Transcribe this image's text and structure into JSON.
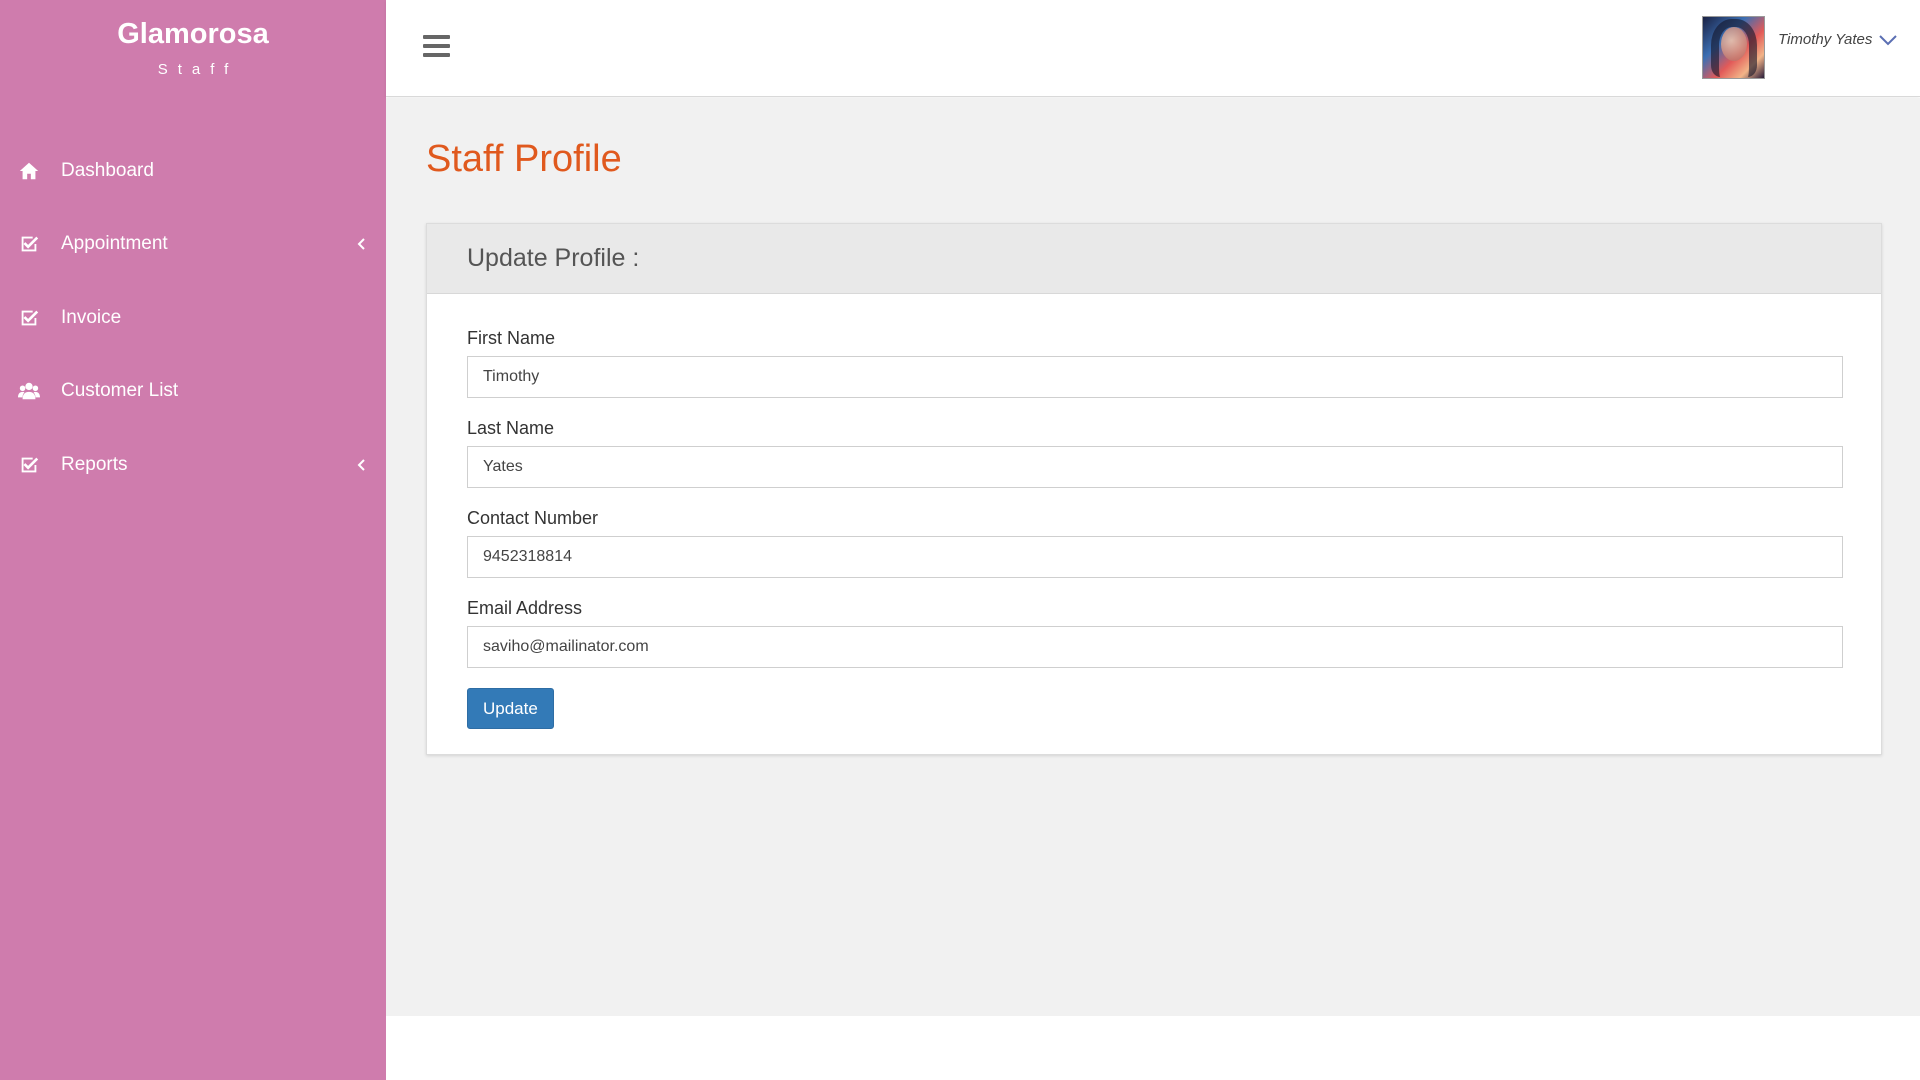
{
  "brand": {
    "name": "Glamorosa",
    "subtitle": "Staff"
  },
  "sidebar": {
    "items": [
      {
        "label": "Dashboard",
        "icon": "home-icon",
        "has_submenu": false
      },
      {
        "label": "Appointment",
        "icon": "check-square-icon",
        "has_submenu": true
      },
      {
        "label": "Invoice",
        "icon": "check-square-icon",
        "has_submenu": false
      },
      {
        "label": "Customer List",
        "icon": "users-icon",
        "has_submenu": false
      },
      {
        "label": "Reports",
        "icon": "check-square-icon",
        "has_submenu": true
      }
    ]
  },
  "topbar": {
    "menu_icon": "hamburger-icon",
    "user_name": "Timothy Yates",
    "dropdown_icon": "chevron-down-icon"
  },
  "page": {
    "title": "Staff Profile"
  },
  "form": {
    "heading": "Update Profile :",
    "first_name": {
      "label": "First Name",
      "value": "Timothy"
    },
    "last_name": {
      "label": "Last Name",
      "value": "Yates"
    },
    "contact": {
      "label": "Contact Number",
      "value": "9452318814"
    },
    "email": {
      "label": "Email Address",
      "value": "saviho@mailinator.com"
    },
    "submit_label": "Update"
  },
  "colors": {
    "sidebar": "#cf7cad",
    "title": "#e0591e",
    "button": "#337ab7",
    "accent": "#5b6fb3"
  }
}
